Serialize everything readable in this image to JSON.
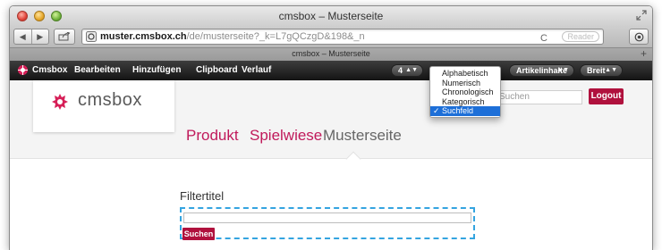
{
  "browser": {
    "window_title": "cmsbox – Musterseite",
    "url_host": "muster.cmsbox.ch",
    "url_path": "/de/musterseite?_k=L7gQCzgD&198&_n",
    "reader_label": "Reader",
    "tab_title": "cmsbox – Musterseite",
    "reload_glyph": "C",
    "add_tab_glyph": "+"
  },
  "cms_toolbar": {
    "brand": "Cmsbox",
    "menu": [
      "Bearbeiten",
      "Hinzufügen",
      "Clipboard",
      "Verlauf"
    ],
    "count_select": "4",
    "content_select": "Artikelinhalte",
    "width_select": "Breit"
  },
  "dropdown": {
    "options": [
      "Alphabetisch",
      "Numerisch",
      "Chronologisch",
      "Kategorisch",
      "Suchfeld"
    ],
    "selected": "Suchfeld",
    "check_glyph": "✓"
  },
  "page": {
    "logo_text": "cmsbox",
    "search_placeholder": "Suchen",
    "logout_label": "Logout",
    "nav": [
      "Produkt",
      "Spielwiese",
      "Musterseite"
    ],
    "active_nav": "Musterseite",
    "filter_title": "Filtertitel",
    "search_button_label": "Suchen"
  },
  "colors": {
    "accent": "#b0113d",
    "nav_link": "#c0195a",
    "selection": "#1d6fd8",
    "dashed_frame": "#34a4e0"
  }
}
